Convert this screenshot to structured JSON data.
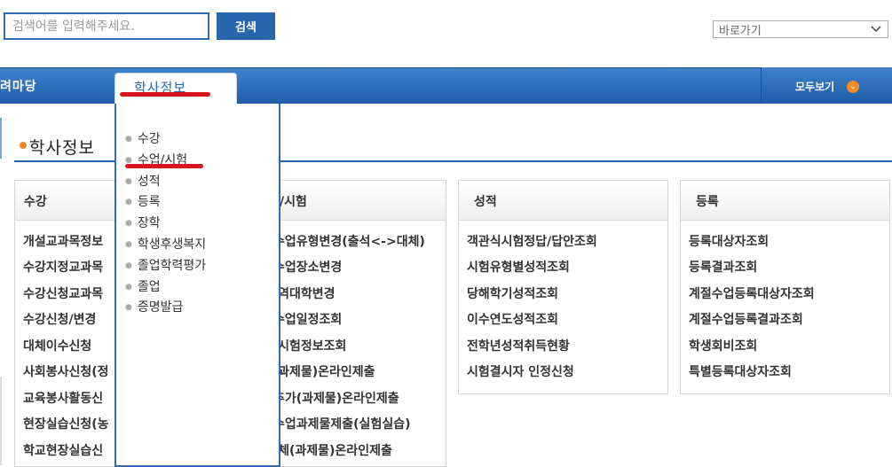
{
  "search": {
    "placeholder": "검색어를 입력해주세요.",
    "button_label": "검색"
  },
  "shortcut": {
    "label": "바로가기"
  },
  "nav": {
    "left_label": "려마당",
    "active_tab": "학사정보",
    "view_all": "모두보기"
  },
  "page_title": "학사정보",
  "columns": [
    {
      "title": "수강",
      "items": [
        "개설교과목정보",
        "수강지정교과목",
        "수강신청교과목",
        "수강신청/변경",
        "대체이수신청",
        "사회봉사신청(정",
        "교육봉사활동신",
        "현장실습신청(농",
        "학교현장실습신"
      ]
    },
    {
      "title": "/시험",
      "items": [
        "수업유형변경(출석<->대체)",
        "수업장소변경",
        "|역대학변경",
        "수업일정조회",
        "|시험정보조회",
        "|과제물)온라인제출",
        "추가(과제물)온라인제출",
        "수업과제물제출(실험실습)",
        "|체(과제물)온라인제출"
      ]
    },
    {
      "title": "성적",
      "items": [
        "객관식시험정답/답안조회",
        "시험유형별성적조회",
        "당해학기성적조회",
        "이수연도성적조회",
        "전학년성적취득현황",
        "시험결시자 인정신청"
      ]
    },
    {
      "title": "등록",
      "items": [
        "등록대상자조회",
        "등록결과조회",
        "계절수업등록대상자조회",
        "계절수업등록결과조회",
        "학생회비조회",
        "특별등록대상자조회"
      ]
    }
  ],
  "dropdown": {
    "items": [
      "수강",
      "수업/시험",
      "성적",
      "등록",
      "장학",
      "학생후생복지",
      "졸업학력평가",
      "졸업",
      "증명발급"
    ],
    "highlighted": "수업/시험"
  }
}
